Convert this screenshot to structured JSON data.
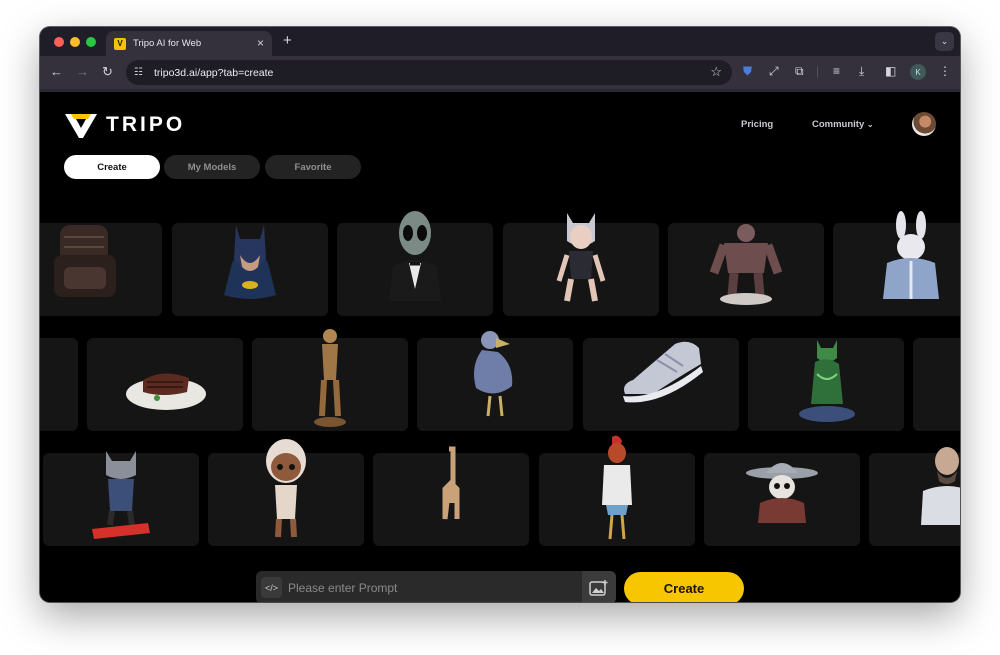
{
  "browser": {
    "tab_title": "Tripo AI for Web",
    "tab_close": "×",
    "new_tab": "+",
    "url": "tripo3d.ai/app?tab=create",
    "profile_initial": "K"
  },
  "header": {
    "logo_text": "TRIPO",
    "nav": {
      "pricing": "Pricing",
      "community": "Community"
    }
  },
  "tabs": [
    "Create",
    "My Models",
    "Favorite"
  ],
  "gallery": {
    "row1": [
      "armchair",
      "batman bust",
      "alien in tuxedo",
      "anime cat girl",
      "hulk figure",
      "bunny in jacket"
    ],
    "row2": [
      "steak on plate",
      "bronze statue",
      "dodo bird",
      "sneaker",
      "green panther"
    ],
    "row3": [
      "cat on skateboard",
      "chibi doll",
      "giraffe",
      "rooster character",
      "cowboy skull",
      "bald man bust"
    ]
  },
  "prompt": {
    "placeholder": "Please enter Prompt",
    "create_label": "Create"
  },
  "colors": {
    "accent": "#f7c600",
    "card": "#151515",
    "page": "#000000"
  }
}
